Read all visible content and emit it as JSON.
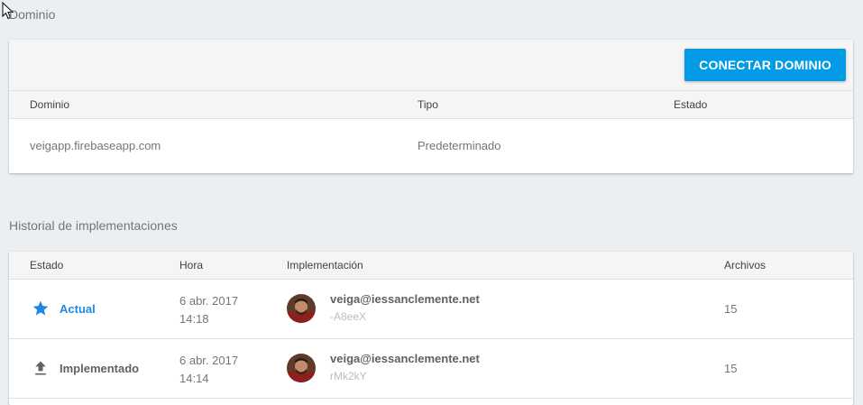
{
  "domain_section": {
    "title": "Dominio",
    "connect_button": "CONECTAR DOMINIO",
    "columns": {
      "domain": "Dominio",
      "type": "Tipo",
      "status": "Estado"
    },
    "rows": [
      {
        "domain": "veigapp.firebaseapp.com",
        "type": "Predeterminado",
        "status": ""
      }
    ]
  },
  "history_section": {
    "title": "Historial de implementaciones",
    "columns": {
      "status": "Estado",
      "time": "Hora",
      "deployment": "Implementación",
      "files": "Archivos"
    },
    "rows": [
      {
        "status": "Actual",
        "status_icon": "star-icon",
        "status_color": "#1e88e5",
        "date": "6 abr. 2017",
        "time": "14:18",
        "email": "veiga@iessanclemente.net",
        "hash": "-A8eeX",
        "files": "15"
      },
      {
        "status": "Implementado",
        "status_icon": "upload-icon",
        "status_color": "#616161",
        "date": "6 abr. 2017",
        "time": "14:14",
        "email": "veiga@iessanclemente.net",
        "hash": "rMk2kY",
        "files": "15"
      }
    ]
  },
  "colors": {
    "accent": "#039be5",
    "background": "#eceff1"
  }
}
